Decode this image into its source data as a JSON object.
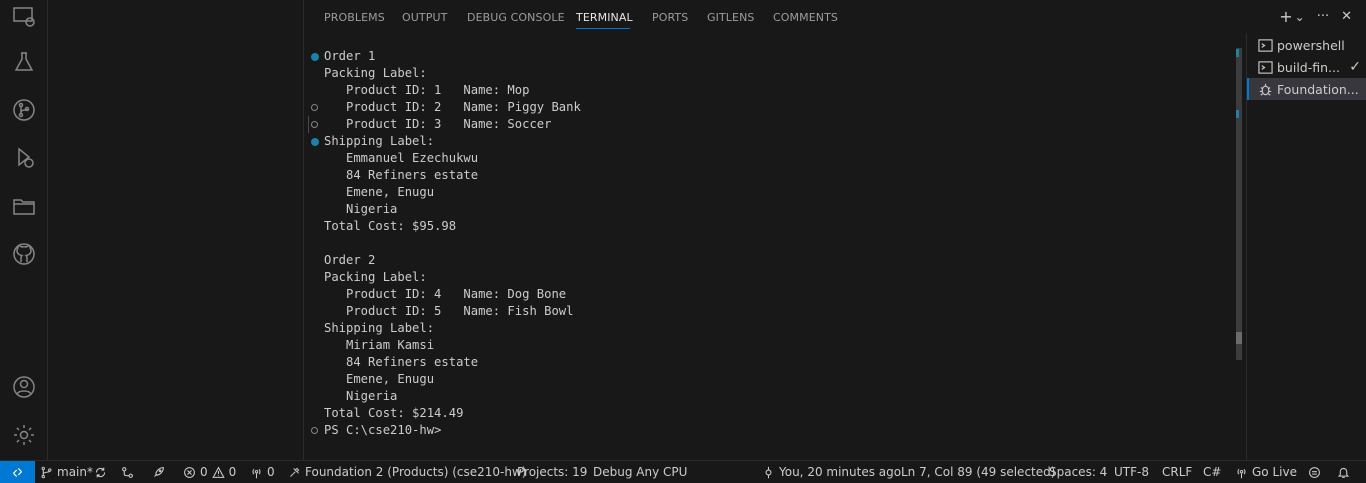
{
  "panel": {
    "tabs": [
      {
        "label": "PROBLEMS"
      },
      {
        "label": "OUTPUT"
      },
      {
        "label": "DEBUG CONSOLE"
      },
      {
        "label": "TERMINAL"
      },
      {
        "label": "PORTS"
      },
      {
        "label": "GITLENS"
      },
      {
        "label": "COMMENTS"
      }
    ],
    "active_tab": "TERMINAL",
    "actions": {
      "add": "+",
      "dropdown": "⌄",
      "more": "···",
      "close": "✕"
    }
  },
  "terminal": {
    "lines": [
      "Order 1",
      "Packing Label:",
      "   Product ID: 1   Name: Mop",
      "   Product ID: 2   Name: Piggy Bank",
      "   Product ID: 3   Name: Soccer",
      "Shipping Label:",
      "   Emmanuel Ezechukwu",
      "   84 Refiners estate",
      "   Emene, Enugu",
      "   Nigeria",
      "Total Cost: $95.98",
      "",
      "Order 2",
      "Packing Label:",
      "   Product ID: 4   Name: Dog Bone",
      "   Product ID: 5   Name: Fish Bowl",
      "Shipping Label:",
      "   Miriam Kamsi",
      "   84 Refiners estate",
      "   Emene, Enugu",
      "   Nigeria",
      "Total Cost: $214.49",
      "PS C:\\cse210-hw>"
    ]
  },
  "terminal_list": {
    "items": [
      {
        "label": "powershell",
        "icon": "terminal-icon"
      },
      {
        "label": "build-fin...",
        "icon": "terminal-icon",
        "status": "✓"
      },
      {
        "label": "Foundation...",
        "icon": "debug-icon"
      }
    ]
  },
  "statusbar": {
    "branch": "main*",
    "errors": "0",
    "warnings": "0",
    "ports": "0",
    "project": "Foundation 2 (Products) (cse210-hw)",
    "projects": "Projects: 19",
    "debug": "Debug Any CPU",
    "blame": "You, 20 minutes ago",
    "cursor": "Ln 7, Col 89 (49 selected)",
    "spaces": "Spaces: 4",
    "encoding": "UTF-8",
    "eol": "CRLF",
    "language": "C#",
    "golive": "Go Live"
  },
  "colors": {
    "accent": "#0078d4",
    "background": "#181818",
    "decoration_blue": "#1b81a8"
  }
}
